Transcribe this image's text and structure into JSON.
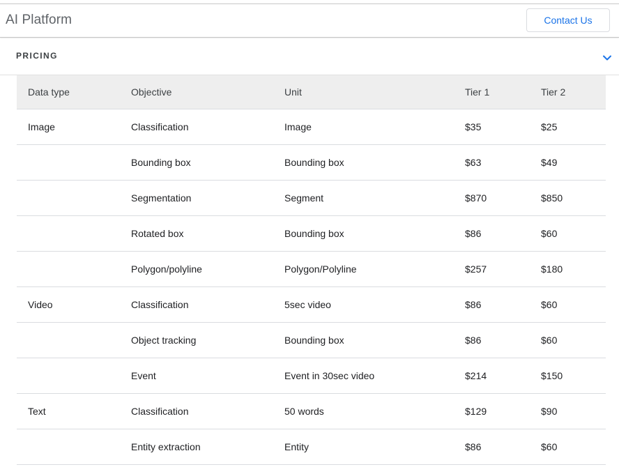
{
  "header": {
    "title": "AI Platform",
    "contact_label": "Contact Us"
  },
  "section": {
    "title": "PRICING",
    "chevron_icon": "chevron-down-icon"
  },
  "colors": {
    "accent": "#1a73e8",
    "header_row_bg": "#eeeeee",
    "divider": "#dadce0"
  },
  "table": {
    "columns": [
      "Data type",
      "Objective",
      "Unit",
      "Tier 1",
      "Tier 2"
    ],
    "rows": [
      {
        "data_type": "Image",
        "objective": "Classification",
        "unit": "Image",
        "tier1": "$35",
        "tier2": "$25"
      },
      {
        "data_type": "",
        "objective": "Bounding box",
        "unit": "Bounding box",
        "tier1": "$63",
        "tier2": "$49"
      },
      {
        "data_type": "",
        "objective": "Segmentation",
        "unit": "Segment",
        "tier1": "$870",
        "tier2": "$850"
      },
      {
        "data_type": "",
        "objective": "Rotated box",
        "unit": "Bounding box",
        "tier1": "$86",
        "tier2": "$60"
      },
      {
        "data_type": "",
        "objective": "Polygon/polyline",
        "unit": "Polygon/Polyline",
        "tier1": "$257",
        "tier2": "$180"
      },
      {
        "data_type": "Video",
        "objective": "Classification",
        "unit": "5sec video",
        "tier1": "$86",
        "tier2": "$60"
      },
      {
        "data_type": "",
        "objective": "Object tracking",
        "unit": "Bounding box",
        "tier1": "$86",
        "tier2": "$60"
      },
      {
        "data_type": "",
        "objective": "Event",
        "unit": "Event in 30sec video",
        "tier1": "$214",
        "tier2": "$150"
      },
      {
        "data_type": "Text",
        "objective": "Classification",
        "unit": "50 words",
        "tier1": "$129",
        "tier2": "$90"
      },
      {
        "data_type": "",
        "objective": "Entity extraction",
        "unit": "Entity",
        "tier1": "$86",
        "tier2": "$60"
      }
    ]
  }
}
